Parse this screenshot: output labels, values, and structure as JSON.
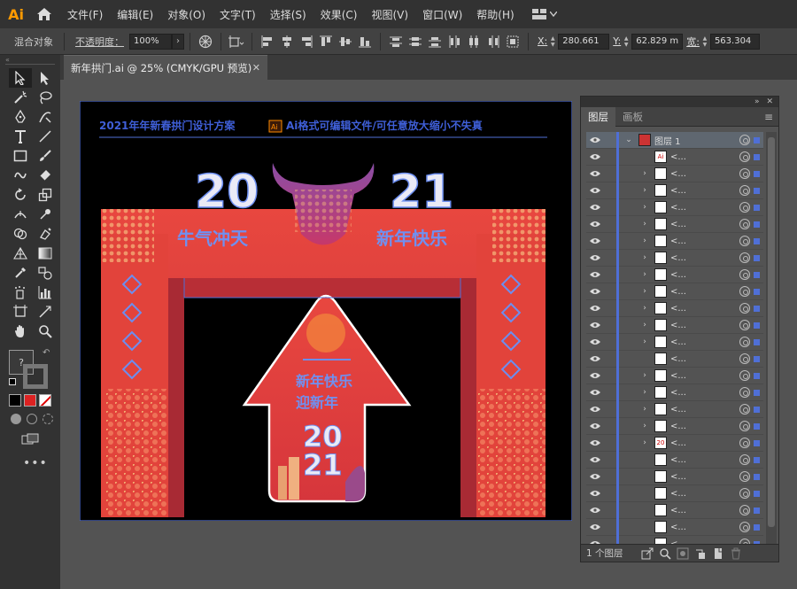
{
  "app": {
    "logo": "Ai"
  },
  "menu": [
    "文件(F)",
    "编辑(E)",
    "对象(O)",
    "文字(T)",
    "选择(S)",
    "效果(C)",
    "视图(V)",
    "窗口(W)",
    "帮助(H)"
  ],
  "control_bar": {
    "object_type": "混合对象",
    "opacity_label": "不透明度：",
    "opacity_value": "100%",
    "x_label": "X:",
    "x_value": "280.661",
    "y_label": "Y:",
    "y_value": "62.829 m",
    "w_label": "宽:",
    "w_value": "563.304"
  },
  "document_tab": {
    "title": "新年拱门.ai @ 25% (CMYK/GPU 预览)"
  },
  "artwork": {
    "header_text": "2021年年新春拱门设计方案",
    "header_text2": "Ai格式可编辑文件/可任意放大缩小不失真",
    "file_badge": "Ai",
    "year_left": "20",
    "year_right": "21",
    "slogan_left": "牛气冲天",
    "slogan_right": "新年快乐",
    "arrow_text1": "新年快乐",
    "arrow_text2": "迎新年",
    "arrow_year1": "20",
    "arrow_year2": "21"
  },
  "layers_panel": {
    "tabs": [
      "图层",
      "画板"
    ],
    "top_layer": "图层 1",
    "sublayer_label": "<...",
    "footer_count": "1 个图层",
    "rows": [
      {
        "expand": false,
        "thumb": "Ai"
      },
      {
        "expand": true,
        "thumb": ""
      },
      {
        "expand": true,
        "thumb": ""
      },
      {
        "expand": true,
        "thumb": ""
      },
      {
        "expand": true,
        "thumb": ""
      },
      {
        "expand": true,
        "thumb": ""
      },
      {
        "expand": true,
        "thumb": ""
      },
      {
        "expand": true,
        "thumb": ""
      },
      {
        "expand": true,
        "thumb": ""
      },
      {
        "expand": true,
        "thumb": ""
      },
      {
        "expand": true,
        "thumb": ""
      },
      {
        "expand": true,
        "thumb": ""
      },
      {
        "expand": false,
        "thumb": ""
      },
      {
        "expand": true,
        "thumb": ""
      },
      {
        "expand": true,
        "thumb": ""
      },
      {
        "expand": true,
        "thumb": ""
      },
      {
        "expand": true,
        "thumb": ""
      },
      {
        "expand": true,
        "thumb": "20"
      },
      {
        "expand": false,
        "thumb": ""
      },
      {
        "expand": false,
        "thumb": ""
      },
      {
        "expand": false,
        "thumb": ""
      },
      {
        "expand": false,
        "thumb": ""
      },
      {
        "expand": false,
        "thumb": ""
      },
      {
        "expand": false,
        "thumb": ""
      }
    ]
  },
  "colors": {
    "accent": "#4f6fd6",
    "arch": "#e2433b",
    "logo": "#ff9a00"
  }
}
